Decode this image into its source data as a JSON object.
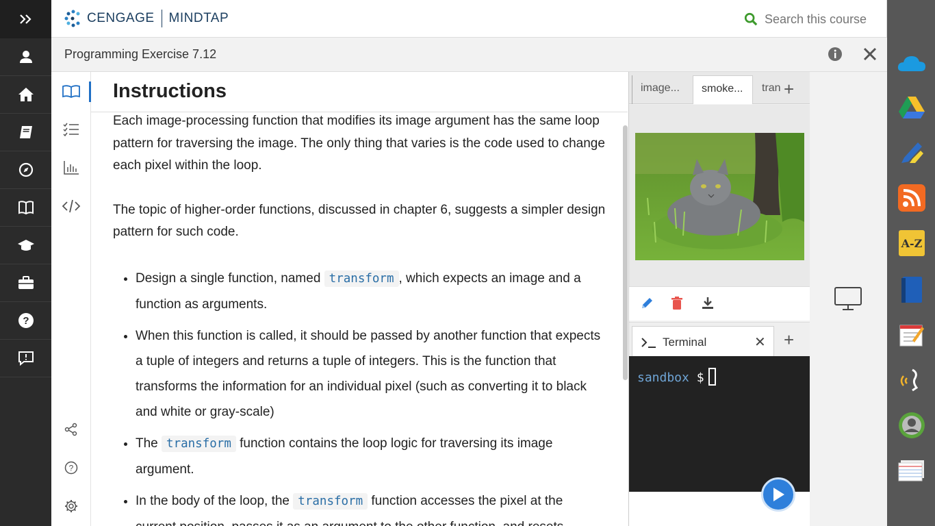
{
  "header": {
    "brand": "CENGAGE",
    "product": "MINDTAP",
    "search_placeholder": "Search this course"
  },
  "titlebar": {
    "title": "Programming Exercise 7.12"
  },
  "instructions": {
    "heading": "Instructions",
    "para1": "Each image-processing function that modifies its image argument has the same loop pattern for traversing the image. The only thing that varies is the code used to change each pixel within the loop.",
    "para2": "The topic of higher-order functions, discussed in chapter 6, suggests a simpler design pattern for such code.",
    "bullets": [
      {
        "pre": "Design a single function, named ",
        "code": "transform",
        "post": ", which expects an image and a function as arguments."
      },
      {
        "pre": "When this function is called, it should be passed by another function that expects a tuple of integers and returns a tuple of integers. This is the function that transforms the information for an individual pixel (such as converting it to black and white or gray-scale)",
        "code": "",
        "post": ""
      },
      {
        "pre": "The ",
        "code": "transform",
        "post": " function contains the loop logic for traversing its image argument."
      },
      {
        "pre": "In the body of the loop, the ",
        "code": "transform",
        "post": " function accesses the pixel at the current position, passes it as an argument to the other function, and resets"
      }
    ]
  },
  "workspace": {
    "tabs": [
      "image...",
      "smoke...",
      "tran"
    ],
    "active_tab": 1,
    "terminal_tab": "Terminal",
    "prompt_host": "sandbox",
    "prompt_symbol": "$"
  },
  "colors": {
    "accent": "#1f6fc5",
    "nav_bg": "#2b2b2b",
    "terminal_bg": "#222222",
    "run_button": "#2e7fdb"
  },
  "icons": {
    "left_nav": [
      "expand-icon",
      "user-icon",
      "home-icon",
      "book-icon",
      "compass-icon",
      "open-book-icon",
      "graduation-cap-icon",
      "briefcase-icon",
      "help-icon",
      "feedback-icon"
    ],
    "tools": [
      "reader-icon",
      "checklist-icon",
      "chart-icon",
      "code-icon",
      "share-icon",
      "help-icon",
      "settings-icon"
    ],
    "apps": [
      "onedrive-icon",
      "google-drive-icon",
      "pencil-highlighter-icon",
      "rss-icon",
      "dictionary-az-icon",
      "book-app-icon",
      "notepad-icon",
      "readspeaker-icon",
      "avatar-app-icon",
      "flashcards-icon"
    ]
  }
}
